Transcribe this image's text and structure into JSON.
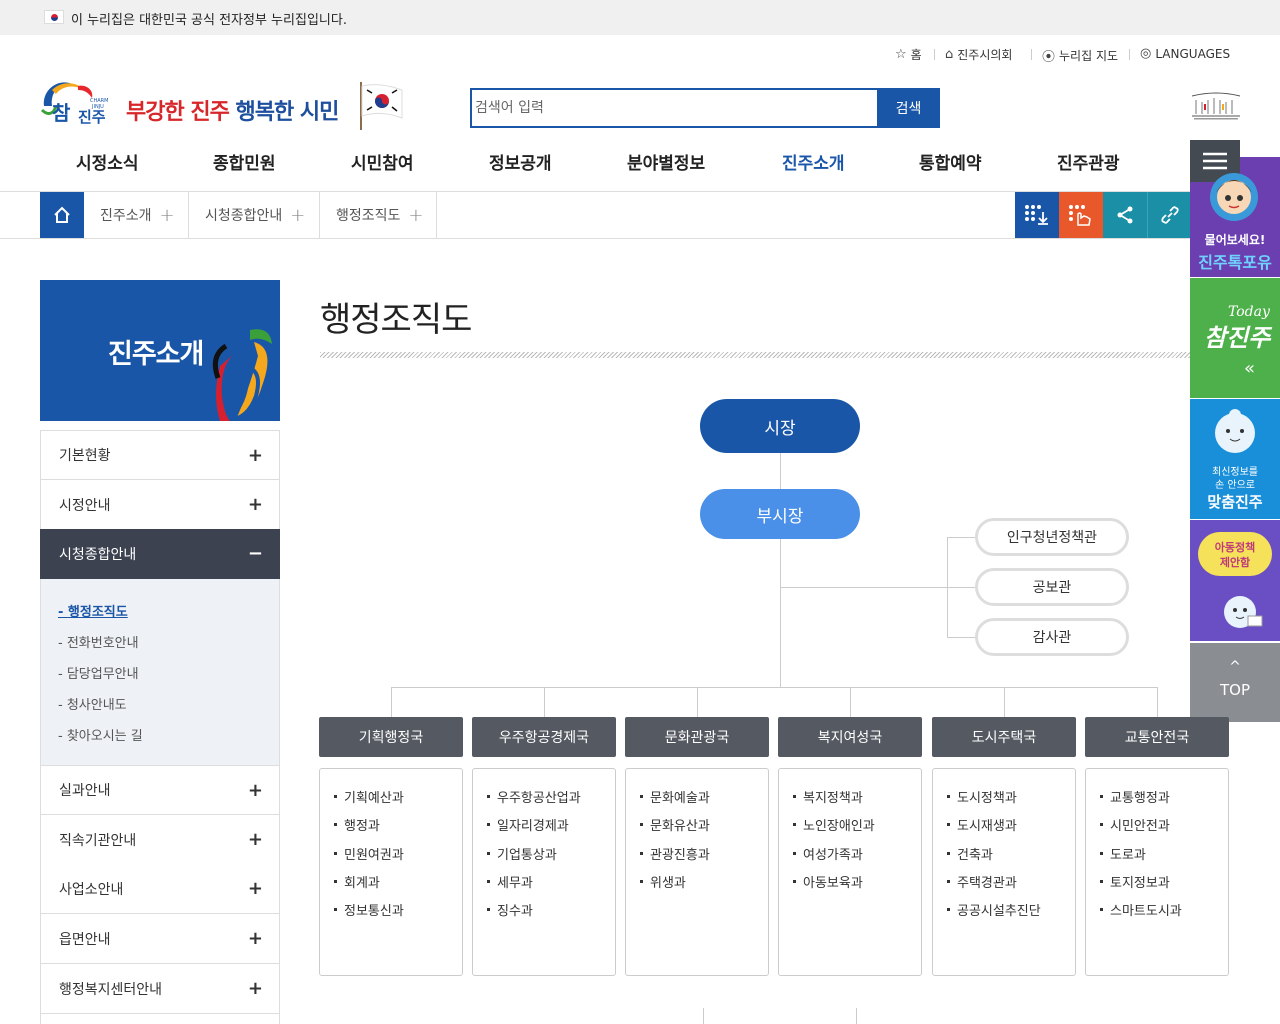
{
  "gov_banner": "이 누리집은 대한민국 공식 전자정부 누리집입니다.",
  "utility": {
    "home": "홈",
    "council": "진주시의회",
    "sitemap": "누리집 지도",
    "languages": "LANGUAGES"
  },
  "logo": {
    "mark_text": "CHARM JINJU",
    "mark_kor": "참진주",
    "slogan_a": "부강한 진주",
    "slogan_b": "행복한 시민"
  },
  "search": {
    "placeholder": "검색어 입력",
    "button": "검색"
  },
  "gnb": [
    "시정소식",
    "종합민원",
    "시민참여",
    "정보공개",
    "분야별정보",
    "진주소개",
    "통합예약",
    "진주관광"
  ],
  "gnb_active": "진주소개",
  "breadcrumb": [
    "진주소개",
    "시청종합안내",
    "행정조직도"
  ],
  "quick_menu": {
    "ask_line1": "물어보세요!",
    "ask_line2": "진주톡포유",
    "today_en": "Today",
    "today_kor": "참진주",
    "custom_line1": "최신정보를",
    "custom_line2": "손 안으로",
    "custom_line3": "맞춤진주",
    "child_line1": "아동정책",
    "child_line2": "제안함",
    "top": "TOP"
  },
  "lnb": {
    "title": "진주소개",
    "items_before": [
      "기본현황",
      "시정안내"
    ],
    "active": "시청종합안내",
    "sub_items": [
      "행정조직도",
      "전화번호안내",
      "담당업무안내",
      "청사안내도",
      "찾아오시는 길"
    ],
    "items_after": [
      "실과안내",
      "직속기관안내",
      "사업소안내",
      "읍면안내",
      "행정복지센터안내"
    ]
  },
  "content": {
    "title": "행정조직도",
    "mayor": "시장",
    "vice_mayor": "부시장",
    "staff": [
      "인구청년정책관",
      "공보관",
      "감사관"
    ],
    "bureaus": [
      {
        "name": "기획행정국",
        "depts": [
          "기획예산과",
          "행정과",
          "민원여권과",
          "회계과",
          "정보통신과"
        ]
      },
      {
        "name": "우주항공경제국",
        "depts": [
          "우주항공산업과",
          "일자리경제과",
          "기업통상과",
          "세무과",
          "징수과"
        ]
      },
      {
        "name": "문화관광국",
        "depts": [
          "문화예술과",
          "문화유산과",
          "관광진흥과",
          "위생과"
        ]
      },
      {
        "name": "복지여성국",
        "depts": [
          "복지정책과",
          "노인장애인과",
          "여성가족과",
          "아동보육과"
        ]
      },
      {
        "name": "도시주택국",
        "depts": [
          "도시정책과",
          "도시재생과",
          "건축과",
          "주택경관과",
          "공공시설추진단"
        ]
      },
      {
        "name": "교통안전국",
        "depts": [
          "교통행정과",
          "시민안전과",
          "도로과",
          "토지정보과",
          "스마트도시과"
        ]
      }
    ]
  },
  "colors": {
    "primary": "#1a56a8",
    "vice_mayor": "#4a90e8",
    "bureau": "#555a62",
    "lnb_active": "#3c4250"
  }
}
